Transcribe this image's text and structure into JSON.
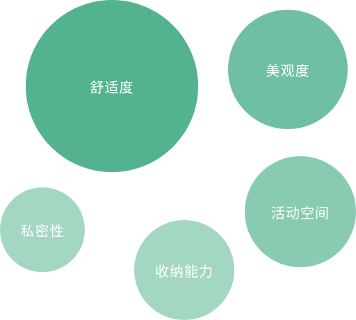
{
  "bubbles": [
    {
      "label": "舒适度",
      "color": "#53b38e"
    },
    {
      "label": "美观度",
      "color": "#6fc0a3"
    },
    {
      "label": "活动空间",
      "color": "#88cbb1"
    },
    {
      "label": "私密性",
      "color": "#a3d7c2"
    },
    {
      "label": "收纳能力",
      "color": "#a3d7c2"
    }
  ]
}
